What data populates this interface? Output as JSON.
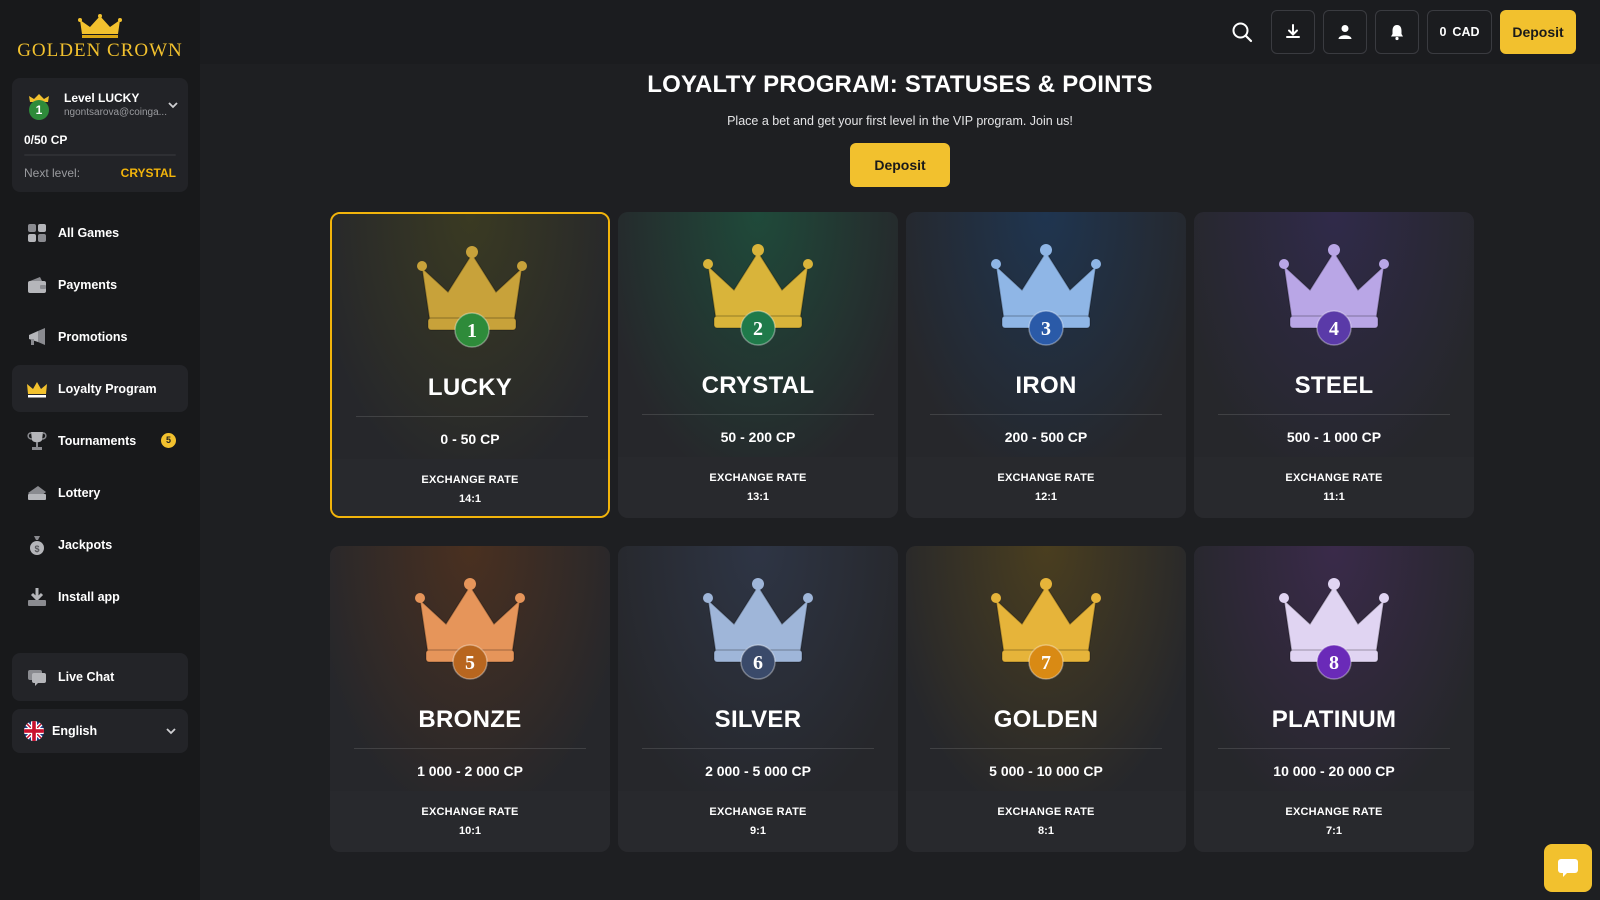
{
  "brand": {
    "name": "GOLDEN CROWN",
    "accent": "#f2c12e"
  },
  "profile": {
    "level_label": "Level LUCKY",
    "level_number": "1",
    "email": "ngontsarova@coinga...",
    "points": "0/50 CP",
    "progress": 0,
    "next_level_label": "Next level:",
    "next_level_value": "CRYSTAL"
  },
  "sidebar": {
    "items": [
      {
        "label": "All Games",
        "icon": "grid-icon"
      },
      {
        "label": "Payments",
        "icon": "wallet-icon"
      },
      {
        "label": "Promotions",
        "icon": "megaphone-icon"
      },
      {
        "label": "Loyalty Program",
        "icon": "crown-icon",
        "active": true
      },
      {
        "label": "Tournaments",
        "icon": "trophy-icon",
        "badge": "5"
      },
      {
        "label": "Lottery",
        "icon": "ticket-icon"
      },
      {
        "label": "Jackpots",
        "icon": "moneybag-icon"
      },
      {
        "label": "Install app",
        "icon": "download-icon"
      }
    ],
    "live_chat": "Live Chat",
    "language": "English"
  },
  "header": {
    "balance_amount": "0",
    "balance_currency": "CAD",
    "deposit_label": "Deposit"
  },
  "main": {
    "title": "LOYALTY PROGRAM: STATUSES & POINTS",
    "subtitle": "Place a bet and get your first level in the VIP program. Join us!",
    "deposit_label": "Deposit",
    "exchange_rate_label": "EXCHANGE RATE",
    "levels": [
      {
        "number": "1",
        "name": "LUCKY",
        "range": "0 - 50 CP",
        "rate": "14:1",
        "color": "#c8a23a",
        "badge": "#2e8b3a",
        "bg": "#3a3a22",
        "current": true
      },
      {
        "number": "2",
        "name": "CRYSTAL",
        "range": "50 - 200 CP",
        "rate": "13:1",
        "color": "#d9b43a",
        "badge": "#1f7a4a",
        "bg": "#1f4a3a"
      },
      {
        "number": "3",
        "name": "IRON",
        "range": "200 - 500 CP",
        "rate": "12:1",
        "color": "#8fb6e6",
        "badge": "#2a5aa8",
        "bg": "#1f3550"
      },
      {
        "number": "4",
        "name": "STEEL",
        "range": "500 - 1 000 CP",
        "rate": "11:1",
        "color": "#b9a6e6",
        "badge": "#5a3aa8",
        "bg": "#302a4a"
      },
      {
        "number": "5",
        "name": "BRONZE",
        "range": "1 000 - 2 000 CP",
        "rate": "10:1",
        "color": "#e6955a",
        "badge": "#b8661f",
        "bg": "#4a3020"
      },
      {
        "number": "6",
        "name": "SILVER",
        "range": "2 000 - 5 000 CP",
        "rate": "9:1",
        "color": "#9fb6d9",
        "badge": "#3a4a6a",
        "bg": "#2e3545"
      },
      {
        "number": "7",
        "name": "GOLDEN",
        "range": "5 000 - 10 000 CP",
        "rate": "8:1",
        "color": "#e6b43a",
        "badge": "#d98a14",
        "bg": "#4a3e1f"
      },
      {
        "number": "8",
        "name": "PLATINUM",
        "range": "10 000 - 20 000 CP",
        "rate": "7:1",
        "color": "#e0d4f2",
        "badge": "#6a2ab8",
        "bg": "#3a2a4a"
      }
    ]
  }
}
